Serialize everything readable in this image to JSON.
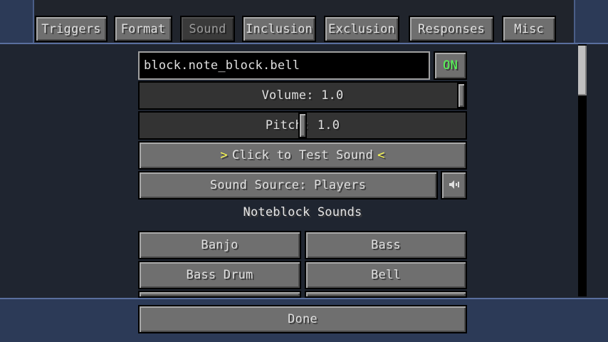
{
  "tabs": [
    {
      "label": "Triggers"
    },
    {
      "label": "Format"
    },
    {
      "label": "Sound"
    },
    {
      "label": "Inclusion"
    },
    {
      "label": "Exclusion"
    },
    {
      "label": "Responses"
    },
    {
      "label": "Misc"
    }
  ],
  "sound": {
    "id_value": "block.note_block.bell",
    "toggle_label": "ON",
    "volume_label": "Volume: 1.0",
    "volume_level": 1.0,
    "pitch_label": "Pitch: 1.0",
    "pitch_level": 0.5,
    "test_prefix": ">",
    "test_label": "Click to Test Sound",
    "test_suffix": "<",
    "source_label": "Sound Source: Players",
    "source_icon": "speaker-icon",
    "section_title": "Noteblock Sounds"
  },
  "noteblock_sounds": [
    "Banjo",
    "Bass",
    "Bass Drum",
    "Bell"
  ],
  "done_label": "Done",
  "colors": {
    "toggle_on": "#55ff55",
    "test_arrow": "#ffff55"
  }
}
